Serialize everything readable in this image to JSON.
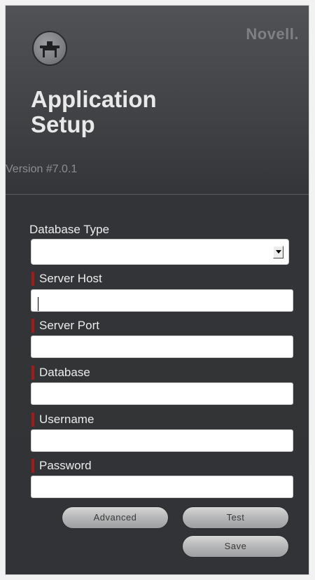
{
  "header": {
    "brand": "Novell.",
    "title_line1": "Application",
    "title_line2": "Setup",
    "version": "Version #7.0.1",
    "logo_icon": "workstation-icon"
  },
  "form": {
    "database_type": {
      "label": "Database Type",
      "value": ""
    },
    "server_host": {
      "label": "Server Host",
      "value": "",
      "required": true
    },
    "server_port": {
      "label": "Server Port",
      "value": "",
      "required": true
    },
    "database": {
      "label": "Database",
      "value": "",
      "required": true
    },
    "username": {
      "label": "Username",
      "value": "",
      "required": true
    },
    "password": {
      "label": "Password",
      "value": "",
      "required": true
    }
  },
  "buttons": {
    "advanced": "Advanced",
    "test": "Test",
    "save": "Save"
  },
  "colors": {
    "panel_bg": "#313336",
    "required_marker": "#a4191a",
    "title_text": "#e9e9e9",
    "brand_text": "#7e8084"
  }
}
